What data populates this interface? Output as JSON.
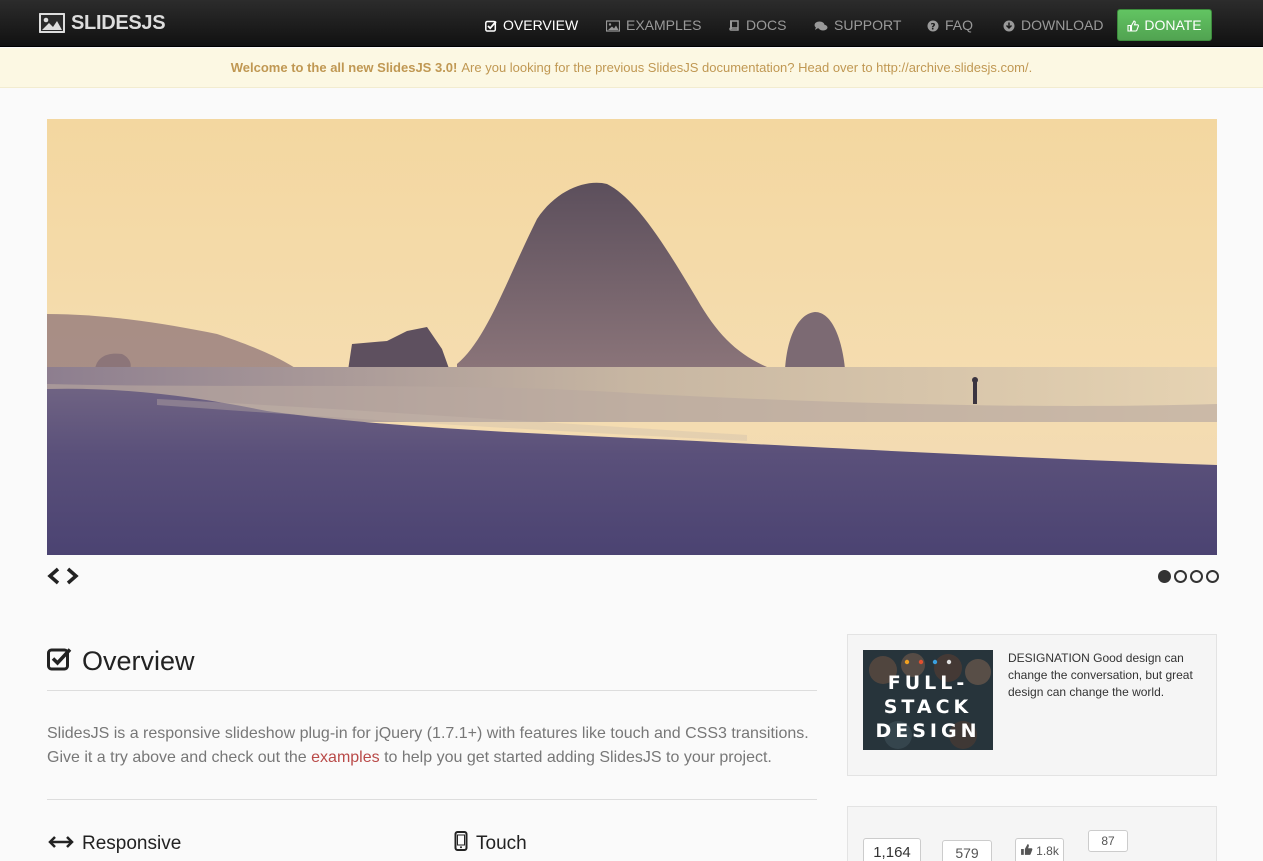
{
  "brand": {
    "name": "SLIDESJS"
  },
  "nav": {
    "items": [
      {
        "label": "OVERVIEW",
        "icon": "check-square-icon",
        "active": true
      },
      {
        "label": "EXAMPLES",
        "icon": "picture-icon"
      },
      {
        "label": "DOCS",
        "icon": "book-icon"
      },
      {
        "label": "SUPPORT",
        "icon": "comments-icon"
      },
      {
        "label": "FAQ",
        "icon": "question-circle-icon"
      },
      {
        "label": "DOWNLOAD",
        "icon": "download-icon"
      }
    ],
    "donate": {
      "label": "DONATE",
      "icon": "thumbs-up-icon",
      "color": "#5bb75b"
    }
  },
  "alert": {
    "strong": "Welcome to the all new SlidesJS 3.0!",
    "text": "Are you looking for the previous SlidesJS documentation? Head over to http://archive.slidesjs.com/."
  },
  "slideshow": {
    "current_slide": 1,
    "total_slides": 4
  },
  "overview": {
    "title": "Overview",
    "text_before": "SlidesJS is a responsive slideshow plug-in for jQuery (1.7.1+) with features like touch and CSS3 transitions. Give it a try above and check out the ",
    "link": "examples",
    "text_after": " to help you get started adding SlidesJS to your project."
  },
  "features": [
    {
      "label": "Responsive",
      "icon": "resize-horizontal-icon"
    },
    {
      "label": "Touch",
      "icon": "mobile-phone-icon"
    }
  ],
  "ad": {
    "image_text": [
      "FULL-",
      "STACK",
      "DESIGN"
    ],
    "copy": "DESIGNATION Good design can change the conversation, but great design can change the world."
  },
  "social": {
    "count_1": "1,164",
    "count_2": "579",
    "likes": "1.8k",
    "comments": "87"
  }
}
